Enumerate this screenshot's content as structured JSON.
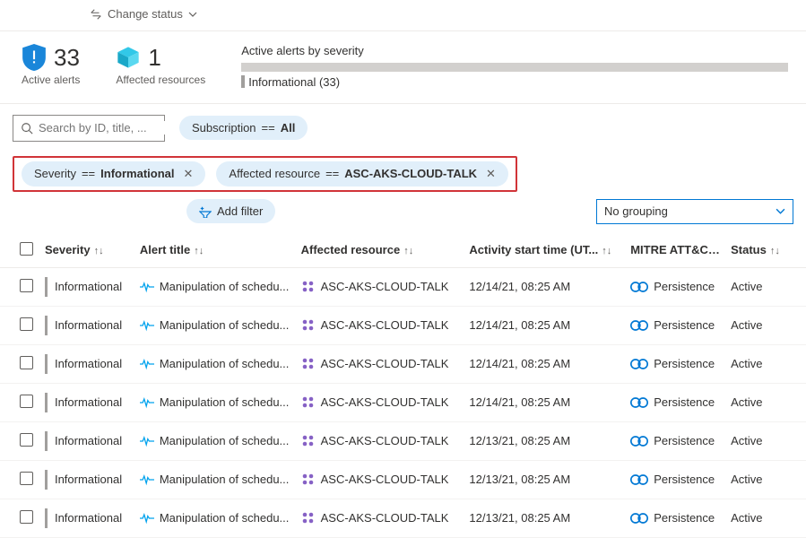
{
  "toolbar": {
    "change_status": "Change status"
  },
  "summary": {
    "active_alerts_count": "33",
    "active_alerts_label": "Active alerts",
    "affected_resources_count": "1",
    "affected_resources_label": "Affected resources",
    "severity_title": "Active alerts by severity",
    "severity_breakdown": "Informational (33)"
  },
  "search": {
    "placeholder": "Search by ID, title, ..."
  },
  "filters": {
    "subscription": {
      "label": "Subscription",
      "op": "==",
      "value": "All"
    },
    "severity": {
      "label": "Severity",
      "op": "==",
      "value": "Informational"
    },
    "resource": {
      "label": "Affected resource",
      "op": "==",
      "value": "ASC-AKS-CLOUD-TALK"
    },
    "add_filter": "Add filter"
  },
  "grouping": {
    "value": "No grouping"
  },
  "columns": {
    "severity": "Severity",
    "title": "Alert title",
    "resource": "Affected resource",
    "time": "Activity start time (UT...",
    "mitre": "MITRE ATT&CK...",
    "status": "Status"
  },
  "rows": [
    {
      "severity": "Informational",
      "title": "Manipulation of schedu...",
      "resource": "ASC-AKS-CLOUD-TALK",
      "time": "12/14/21, 08:25 AM",
      "mitre": "Persistence",
      "status": "Active"
    },
    {
      "severity": "Informational",
      "title": "Manipulation of schedu...",
      "resource": "ASC-AKS-CLOUD-TALK",
      "time": "12/14/21, 08:25 AM",
      "mitre": "Persistence",
      "status": "Active"
    },
    {
      "severity": "Informational",
      "title": "Manipulation of schedu...",
      "resource": "ASC-AKS-CLOUD-TALK",
      "time": "12/14/21, 08:25 AM",
      "mitre": "Persistence",
      "status": "Active"
    },
    {
      "severity": "Informational",
      "title": "Manipulation of schedu...",
      "resource": "ASC-AKS-CLOUD-TALK",
      "time": "12/14/21, 08:25 AM",
      "mitre": "Persistence",
      "status": "Active"
    },
    {
      "severity": "Informational",
      "title": "Manipulation of schedu...",
      "resource": "ASC-AKS-CLOUD-TALK",
      "time": "12/13/21, 08:25 AM",
      "mitre": "Persistence",
      "status": "Active"
    },
    {
      "severity": "Informational",
      "title": "Manipulation of schedu...",
      "resource": "ASC-AKS-CLOUD-TALK",
      "time": "12/13/21, 08:25 AM",
      "mitre": "Persistence",
      "status": "Active"
    },
    {
      "severity": "Informational",
      "title": "Manipulation of schedu...",
      "resource": "ASC-AKS-CLOUD-TALK",
      "time": "12/13/21, 08:25 AM",
      "mitre": "Persistence",
      "status": "Active"
    }
  ]
}
